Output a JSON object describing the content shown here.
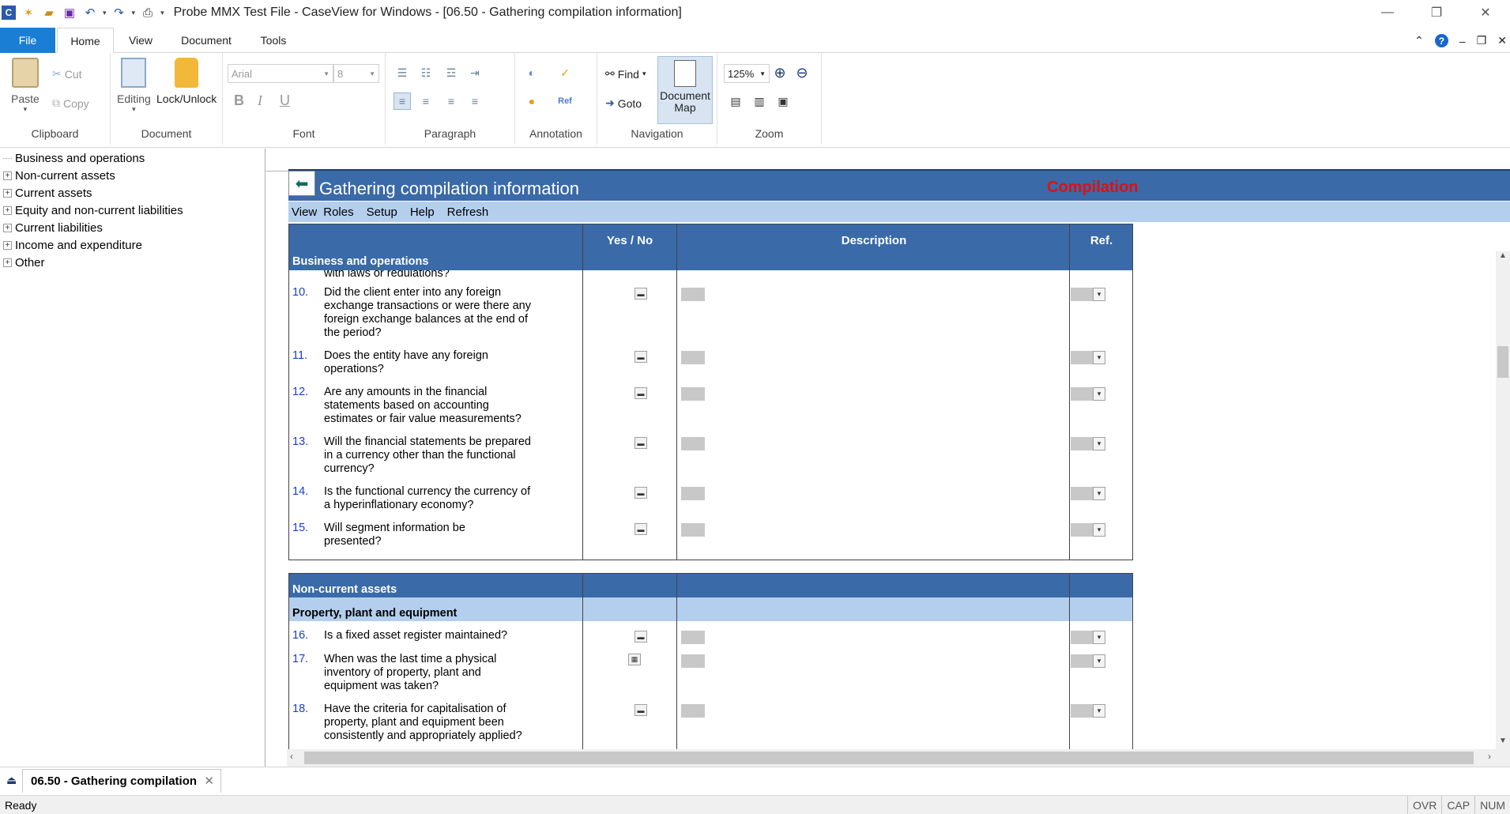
{
  "window": {
    "title": "Probe MMX Test File - CaseView for Windows - [06.50 - Gathering compilation information]"
  },
  "ribbon": {
    "tabs": [
      "File",
      "Home",
      "View",
      "Document",
      "Tools"
    ],
    "groups": {
      "clipboard": {
        "label": "Clipboard",
        "paste": "Paste",
        "cut": "Cut",
        "copy": "Copy"
      },
      "document": {
        "label": "Document",
        "editing": "Editing",
        "lock": "Lock/Unlock"
      },
      "font": {
        "label": "Font",
        "family": "Arial",
        "size": "8",
        "bold": "B",
        "italic": "I",
        "underline": "U"
      },
      "paragraph": {
        "label": "Paragraph"
      },
      "annotation": {
        "label": "Annotation"
      },
      "navigation": {
        "label": "Navigation",
        "find": "Find",
        "goto": "Goto",
        "docmap_line1": "Document",
        "docmap_line2": "Map"
      },
      "zoom": {
        "label": "Zoom",
        "value": "125%"
      }
    }
  },
  "tree": {
    "items": [
      {
        "label": "Business and operations",
        "expandable": false
      },
      {
        "label": "Non-current assets",
        "expandable": true
      },
      {
        "label": "Current assets",
        "expandable": true
      },
      {
        "label": "Equity and non-current liabilities",
        "expandable": true
      },
      {
        "label": "Current liabilities",
        "expandable": true
      },
      {
        "label": "Income and expenditure",
        "expandable": true
      },
      {
        "label": "Other",
        "expandable": true
      }
    ]
  },
  "doc": {
    "header_title": "Gathering compilation information",
    "header_tag": "Compilation",
    "menu": [
      "View",
      "Roles",
      "Setup",
      "Help",
      "Refresh"
    ],
    "columns": {
      "yesno": "Yes / No",
      "description": "Description",
      "ref": "Ref."
    },
    "section1": {
      "title": "Business and operations",
      "cut_text": "with laws or regulations?",
      "questions": [
        {
          "num": "10.",
          "text": "Did the client enter into any foreign exchange transactions or were there any foreign exchange balances at the end of the period?"
        },
        {
          "num": "11.",
          "text": "Does the entity have any foreign operations?"
        },
        {
          "num": "12.",
          "text": "Are any amounts in the financial statements based on accounting estimates or fair value measurements?"
        },
        {
          "num": "13.",
          "text": "Will the financial statements be prepared in a currency other than the functional currency?"
        },
        {
          "num": "14.",
          "text": "Is the functional currency the currency of a hyperinflationary economy?"
        },
        {
          "num": "15.",
          "text": "Will segment information be presented?"
        }
      ]
    },
    "section2": {
      "title": "Non-current assets",
      "subtitle": "Property, plant and equipment",
      "questions": [
        {
          "num": "16.",
          "text": "Is a fixed asset register maintained?"
        },
        {
          "num": "17.",
          "text": "When was the last time a physical inventory of property, plant and equipment was taken?"
        },
        {
          "num": "18.",
          "text": "Have the criteria for capitalisation of property, plant and equipment been consistently and appropriately applied?"
        }
      ]
    }
  },
  "bottom": {
    "doc_tab": "06.50 - Gathering compilation",
    "status": "Ready",
    "indicators": [
      "OVR",
      "CAP",
      "NUM"
    ]
  }
}
